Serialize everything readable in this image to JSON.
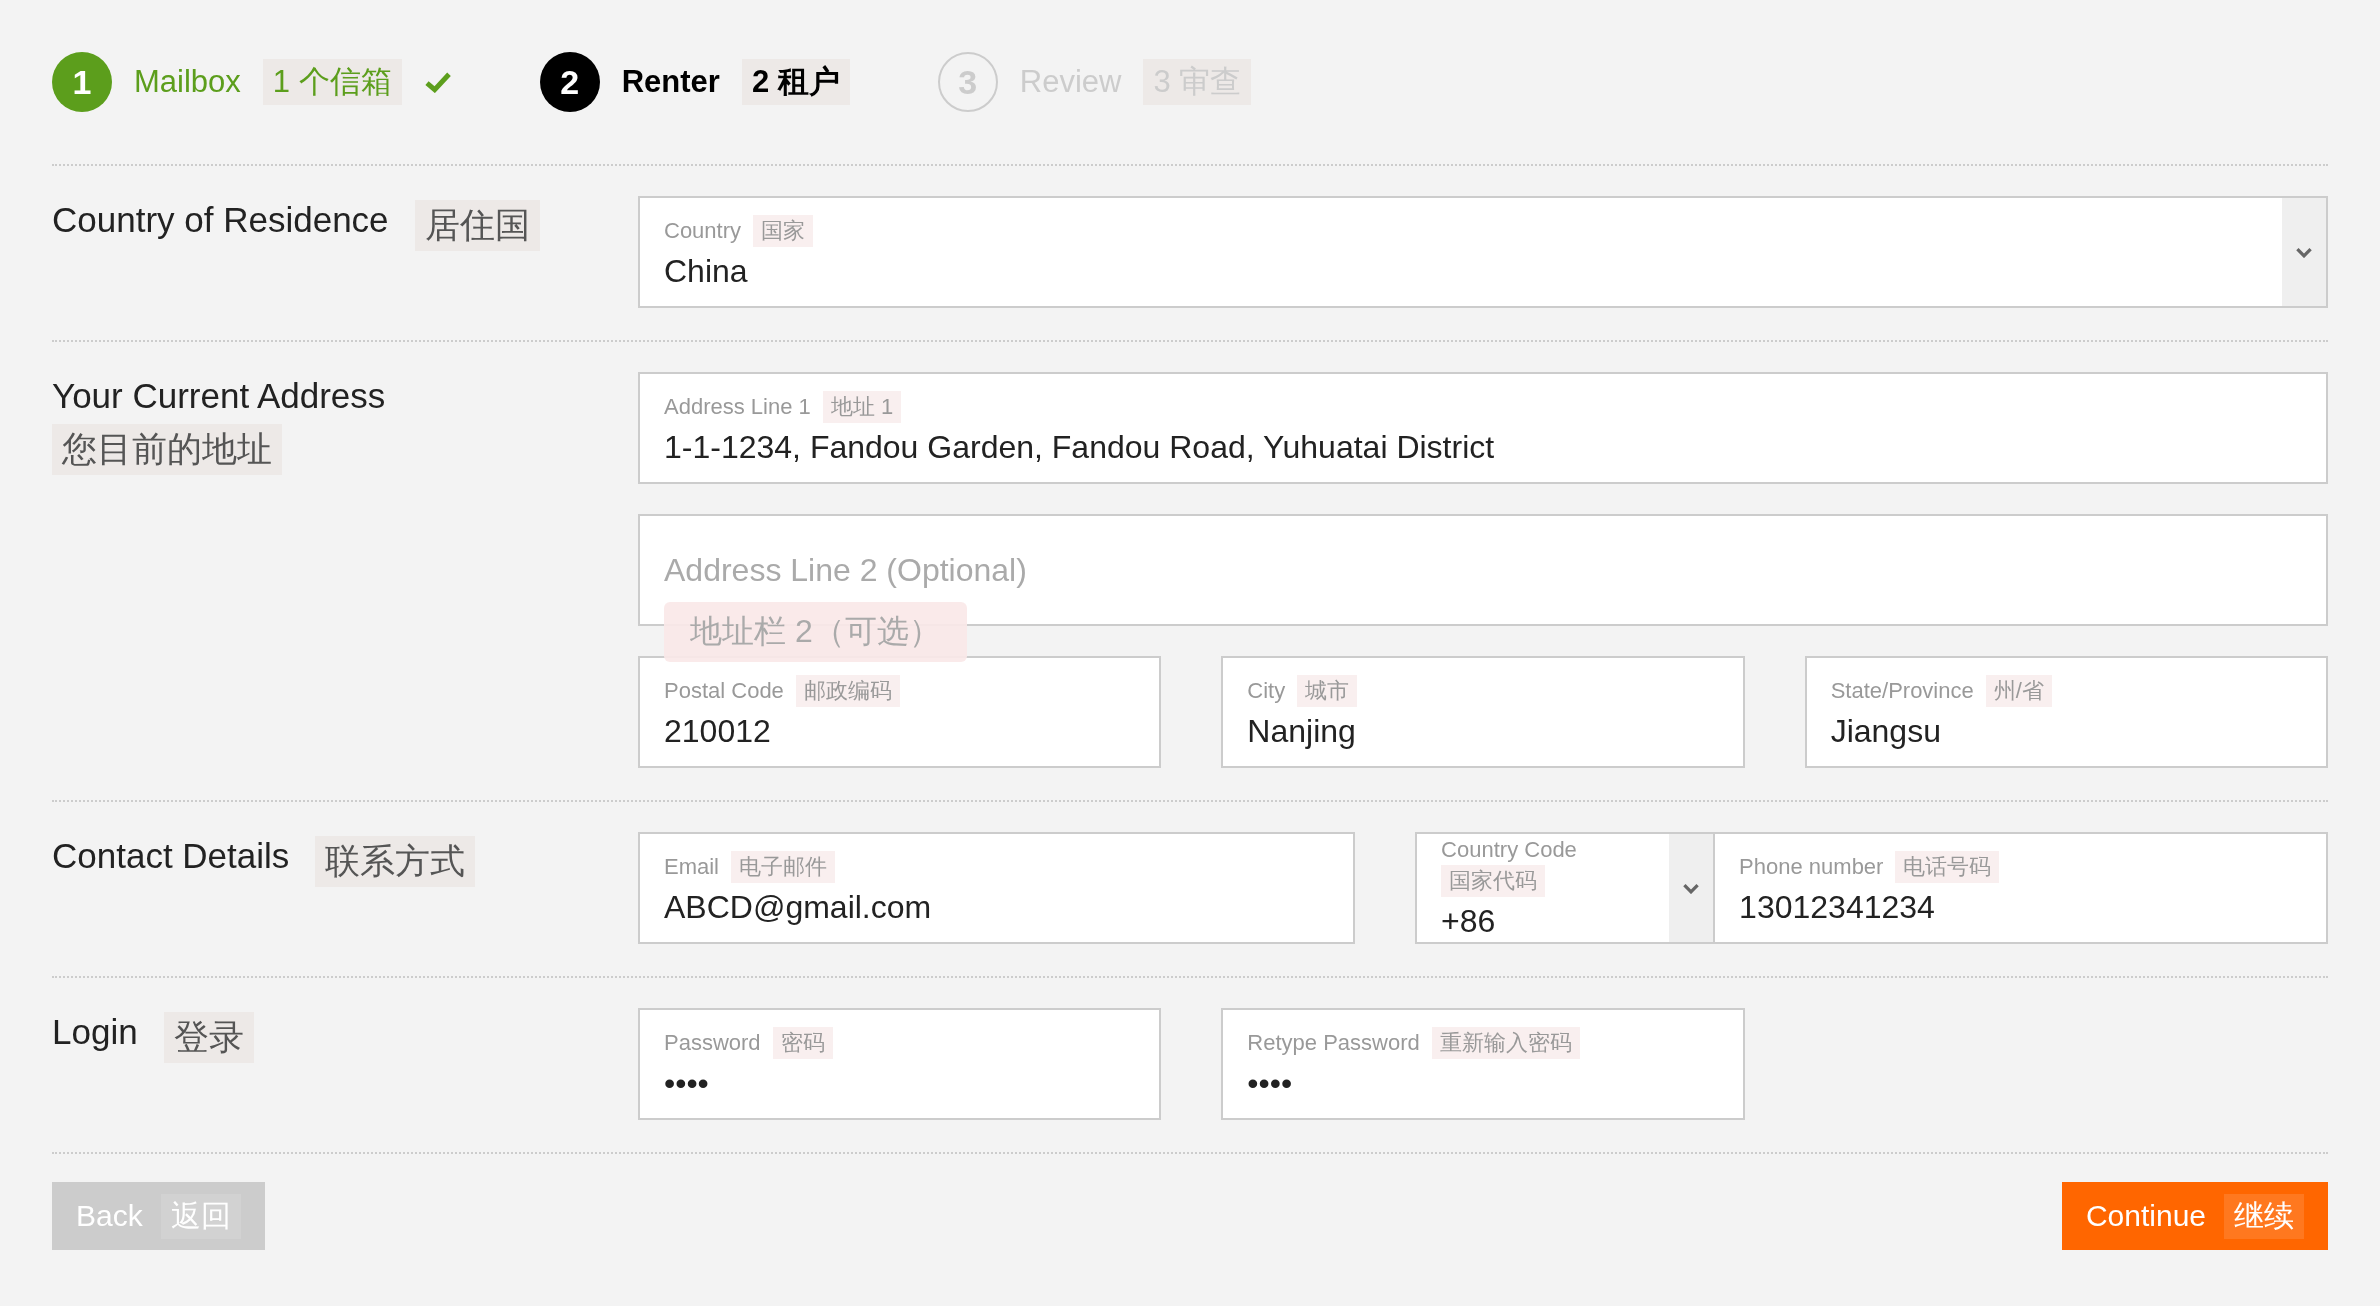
{
  "steps": [
    {
      "number": "1",
      "label": "Mailbox",
      "translation": "1 个信箱",
      "kind": "done"
    },
    {
      "number": "2",
      "label": "Renter",
      "translation": "2 租户",
      "kind": "current"
    },
    {
      "number": "3",
      "label": "Review",
      "translation": "3 审查",
      "kind": "upcoming"
    }
  ],
  "sections": [
    {
      "label": "Country of Residence",
      "translation": "居住国",
      "rows": [
        [
          {
            "kind": "select",
            "label": "Country",
            "translation": "国家",
            "value": "China"
          }
        ]
      ]
    },
    {
      "label": "Your Current Address",
      "translation": "您目前的地址",
      "rows": [
        [
          {
            "kind": "text",
            "label": "Address Line 1",
            "translation": "地址 1",
            "value": "1-1-1234, Fandou Garden, Fandou Road, Yuhuatai District"
          }
        ],
        [
          {
            "kind": "empty",
            "placeholder": "Address Line 2 (Optional)",
            "translation": "地址栏 2（可选）"
          }
        ],
        [
          {
            "kind": "text",
            "label": "Postal Code",
            "translation": "邮政编码",
            "value": "210012"
          },
          {
            "kind": "text",
            "label": "City",
            "translation": "城市",
            "value": "Nanjing"
          },
          {
            "kind": "text",
            "label": "State/Province",
            "translation": "州/省",
            "value": "Jiangsu"
          }
        ]
      ]
    },
    {
      "label": "Contact Details",
      "translation": "联系方式",
      "rows": [
        [
          {
            "kind": "text",
            "label": "Email",
            "translation": "电子邮件",
            "value": "ABCD@gmail.com"
          },
          {
            "kind": "phone",
            "code_label": "Country Code",
            "code_translation": "国家代码",
            "code": "+86",
            "label": "Phone number",
            "translation": "电话号码",
            "value": "13012341234"
          }
        ]
      ]
    },
    {
      "label": "Login",
      "translation": "登录",
      "rows": [
        [
          {
            "kind": "text",
            "label": "Password",
            "translation": "密码",
            "value": "••••"
          },
          {
            "kind": "text",
            "label": "Retype Password",
            "translation": "重新输入密码",
            "value": "••••"
          }
        ]
      ]
    }
  ],
  "back_button": {
    "label": "Back",
    "translation": "返回"
  },
  "continue_button": {
    "label": "Continue",
    "translation": "继续"
  }
}
